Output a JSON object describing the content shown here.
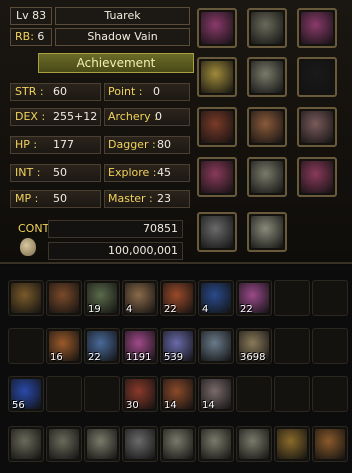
{
  "character": {
    "level_label": "Lv",
    "level": "83",
    "name": "Tuarek",
    "rb_label": "RB:",
    "rb": "6",
    "class": "Shadow Vain",
    "achievement_label": "Achievement"
  },
  "stats": {
    "str_label": "STR :",
    "str": "60",
    "point_label": "Point :",
    "point": "0",
    "dex_label": "DEX :",
    "dex": "255+12",
    "archery_label": "Archery :",
    "archery": "0",
    "hp_label": "HP :",
    "hp": "177",
    "dagger_label": "Dagger :",
    "dagger": "80",
    "int_label": "INT :",
    "int": "50",
    "explore_label": "Explore :",
    "explore": "45",
    "mp_label": "MP :",
    "mp": "50",
    "master_label": "Master :",
    "master": "23"
  },
  "currency": {
    "cont_label": "CONT",
    "cont": "70851",
    "money": "100,000,001"
  },
  "equipment": [
    {
      "name": "amulet-icon",
      "color": "#8a3a6a"
    },
    {
      "name": "helmet-icon",
      "color": "#6a6a5a"
    },
    {
      "name": "amulet-icon",
      "color": "#8a3a6a"
    },
    {
      "name": "necklace-icon",
      "color": "#a08a3a"
    },
    {
      "name": "armor-icon",
      "color": "#7a7a6a"
    },
    {
      "name": "empty-slot-icon",
      "color": "#1a1a1a"
    },
    {
      "name": "glove-icon",
      "color": "#7a3a28"
    },
    {
      "name": "belt-icon",
      "color": "#8a5a3a"
    },
    {
      "name": "glove-icon",
      "color": "#7a5a5a"
    },
    {
      "name": "ring-icon",
      "color": "#8a3a5a"
    },
    {
      "name": "leg-armor-icon",
      "color": "#7a7a6a"
    },
    {
      "name": "ring-icon",
      "color": "#8a3a5a"
    },
    {
      "name": "weapon-icon",
      "color": "#6a6a6a"
    },
    {
      "name": "boots-icon",
      "color": "#8a8a7a"
    }
  ],
  "inventory": {
    "row1": [
      {
        "name": "pendant-icon",
        "qty": "",
        "color": "#7a5a2a"
      },
      {
        "name": "belt-icon",
        "qty": "",
        "color": "#7a4a2a"
      },
      {
        "name": "rune-stone-icon",
        "qty": "19",
        "color": "#5a6a4a"
      },
      {
        "name": "scroll-icon",
        "qty": "4",
        "color": "#8a6a4a"
      },
      {
        "name": "scroll-icon",
        "qty": "22",
        "color": "#9a4a2a"
      },
      {
        "name": "rune-4-icon",
        "qty": "4",
        "color": "#2a4a8a"
      },
      {
        "name": "potion-horn-icon",
        "qty": "22",
        "color": "#9a4a8a"
      },
      {
        "name": "empty-slot-icon",
        "qty": "",
        "color": "#000000"
      },
      {
        "name": "empty-slot-icon",
        "qty": "",
        "color": "#000000"
      }
    ],
    "row2": [
      {
        "name": "empty-slot-icon",
        "qty": "",
        "color": "#000000"
      },
      {
        "name": "orb-icon",
        "qty": "16",
        "color": "#9a5a2a"
      },
      {
        "name": "wand-icon",
        "qty": "22",
        "color": "#4a6a9a"
      },
      {
        "name": "potion-icon",
        "qty": "1191",
        "color": "#a04a8a"
      },
      {
        "name": "crystal-icon",
        "qty": "539",
        "color": "#6a6aaa"
      },
      {
        "name": "map-icon",
        "qty": "",
        "color": "#6a7a8a"
      },
      {
        "name": "ore-icon",
        "qty": "3698",
        "color": "#8a7a5a"
      },
      {
        "name": "empty-slot-icon",
        "qty": "",
        "color": "#000000"
      },
      {
        "name": "empty-slot-icon",
        "qty": "",
        "color": "#000000"
      }
    ],
    "row3": [
      {
        "name": "gem-icon",
        "qty": "56",
        "color": "#2a4aaa"
      },
      {
        "name": "empty-slot-icon",
        "qty": "",
        "color": "#000000"
      },
      {
        "name": "empty-slot-icon",
        "qty": "",
        "color": "#000000"
      },
      {
        "name": "rune-scroll-icon",
        "qty": "30",
        "color": "#8a3a2a"
      },
      {
        "name": "scroll-icon",
        "qty": "14",
        "color": "#8a4a2a"
      },
      {
        "name": "scroll-icon",
        "qty": "14",
        "color": "#7a6a6a"
      },
      {
        "name": "empty-slot-icon",
        "qty": "",
        "color": "#000000"
      },
      {
        "name": "empty-slot-icon",
        "qty": "",
        "color": "#000000"
      },
      {
        "name": "empty-slot-icon",
        "qty": "",
        "color": "#000000"
      }
    ],
    "row4": [
      {
        "name": "gauntlet-icon",
        "qty": "",
        "color": "#6a6a5a"
      },
      {
        "name": "helmet-icon",
        "qty": "",
        "color": "#6a6a5a"
      },
      {
        "name": "armor-icon",
        "qty": "",
        "color": "#7a7a6a"
      },
      {
        "name": "weapon-icon",
        "qty": "",
        "color": "#6a6a6a"
      },
      {
        "name": "leg-armor-icon",
        "qty": "",
        "color": "#7a7a6a"
      },
      {
        "name": "boots-icon",
        "qty": "",
        "color": "#7a7a6a"
      },
      {
        "name": "boots-icon",
        "qty": "",
        "color": "#7a7a6a"
      },
      {
        "name": "ring-icon",
        "qty": "",
        "color": "#8a6a2a"
      },
      {
        "name": "belt-icon",
        "qty": "",
        "color": "#8a5a2a"
      }
    ]
  }
}
